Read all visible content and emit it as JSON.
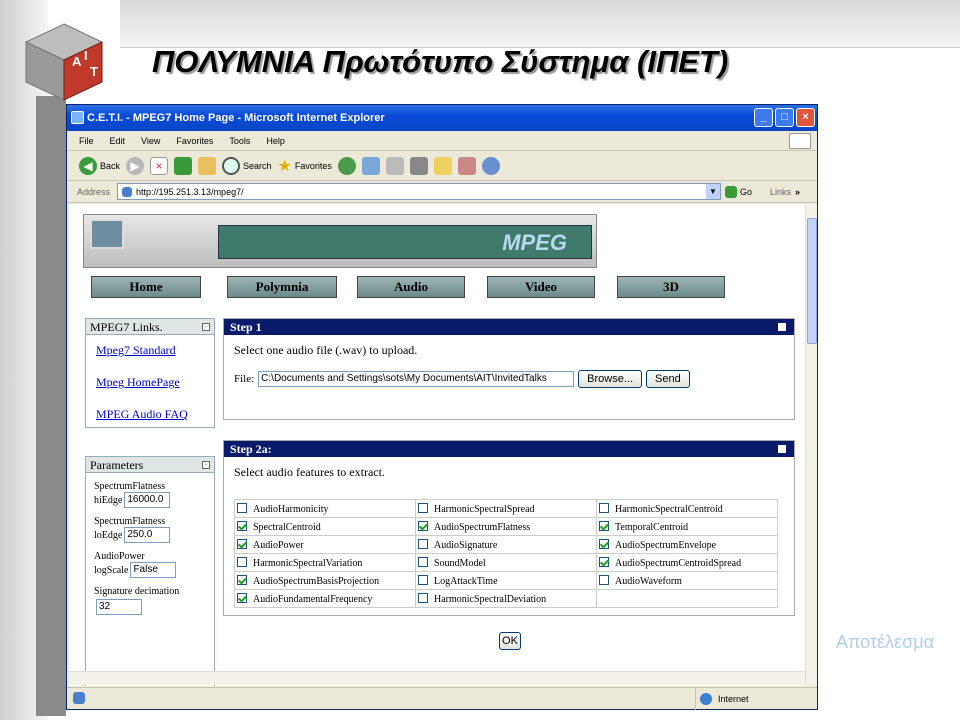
{
  "slide": {
    "title": "ΠΟΛΥΜΝΙΑ Πρωτότυπο Σύστημα (ΙΠΕΤ)",
    "result_link": "Αποτέλεσμα",
    "logo_letters": [
      "A",
      "I",
      "T"
    ]
  },
  "browser": {
    "window_title": "C.E.T.I. - MPEG7 Home Page - Microsoft Internet Explorer",
    "menu": [
      "File",
      "Edit",
      "View",
      "Favorites",
      "Tools",
      "Help"
    ],
    "toolbar": {
      "back": "Back",
      "search": "Search",
      "favorites": "Favorites"
    },
    "address_label": "Address",
    "address_value": "http://195.251.3.13/mpeg7/",
    "go_label": "Go",
    "links_label": "Links",
    "status_zone": "Internet"
  },
  "page": {
    "banner_logo": "MPEG",
    "nav": [
      "Home",
      "Polymnia",
      "Audio",
      "Video",
      "3D"
    ],
    "links_panel": {
      "title": "MPEG7 Links.",
      "links": [
        "Mpeg7 Standard",
        "Mpeg HomePage",
        "MPEG Audio FAQ"
      ]
    },
    "parameters": {
      "title": "Parameters",
      "spectrum1_label": "SpectrumFlatness",
      "hiedge_label": "hiEdge",
      "hiedge_value": "16000.0",
      "spectrum2_label": "SpectrumFlatness",
      "loedge_label": "loEdge",
      "loedge_value": "250.0",
      "audiopower_label": "AudioPower",
      "logscale_label": "logScale",
      "logscale_value": "False",
      "sigdec_label": "Signature decimation",
      "sigdec_value": "32"
    },
    "step1": {
      "title": "Step 1",
      "instruction": "Select one audio file (.wav) to upload.",
      "file_label": "File:",
      "file_value": "C:\\Documents and Settings\\sots\\My Documents\\AIT\\InvitedTalks",
      "browse_label": "Browse...",
      "send_label": "Send"
    },
    "step2": {
      "title": "Step 2a:",
      "instruction": "Select audio features to extract.",
      "features": [
        [
          {
            "label": "AudioHarmonicity",
            "checked": false
          },
          {
            "label": "HarmonicSpectralSpread",
            "checked": false
          },
          {
            "label": "HarmonicSpectralCentroid",
            "checked": false
          }
        ],
        [
          {
            "label": "SpectralCentroid",
            "checked": true
          },
          {
            "label": "AudioSpectrumFlatness",
            "checked": true
          },
          {
            "label": "TemporalCentroid",
            "checked": true
          }
        ],
        [
          {
            "label": "AudioPower",
            "checked": true
          },
          {
            "label": "AudioSignature",
            "checked": false
          },
          {
            "label": "AudioSpectrumEnvelope",
            "checked": true
          }
        ],
        [
          {
            "label": "HarmonicSpectralVariation",
            "checked": false
          },
          {
            "label": "SoundModel",
            "checked": false
          },
          {
            "label": "AudioSpectrumCentroidSpread",
            "checked": true
          }
        ],
        [
          {
            "label": "AudioSpectrumBasisProjection",
            "checked": true
          },
          {
            "label": "LogAttackTime",
            "checked": false
          },
          {
            "label": "AudioWaveform",
            "checked": false
          }
        ],
        [
          {
            "label": "AudioFundamentalFrequency",
            "checked": true
          },
          {
            "label": "HarmonicSpectralDeviation",
            "checked": false
          },
          {
            "label": "",
            "checked": null
          }
        ]
      ],
      "ok_label": "OK"
    }
  },
  "colors": {
    "titlebar": "#0a4bd6",
    "step_header": "#0a1a6a",
    "link": "#0000cc",
    "result_link": "#aecfe9"
  }
}
